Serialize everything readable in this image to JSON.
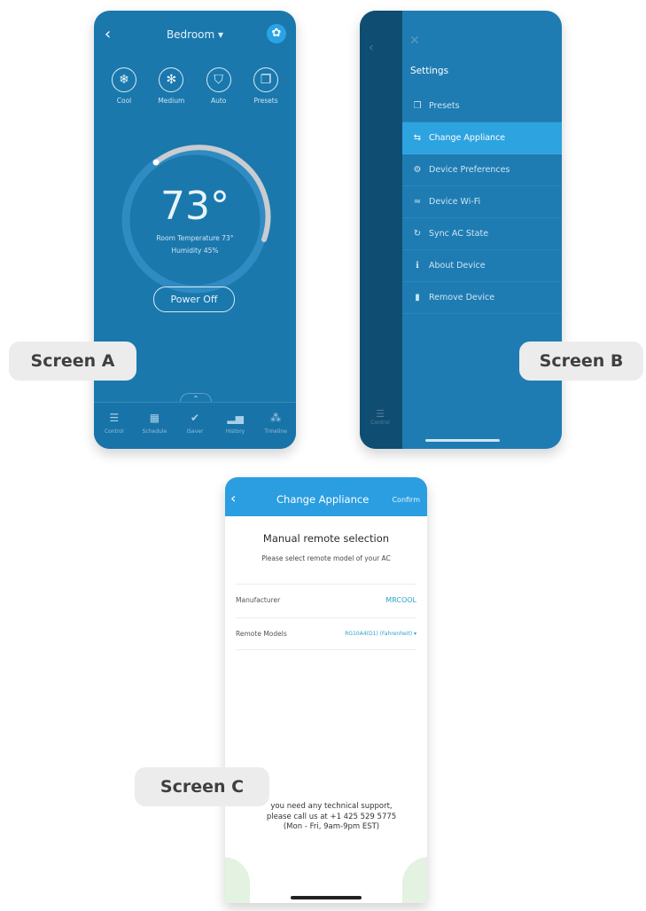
{
  "screen_a": {
    "label": "Screen A",
    "title": "Bedroom ▾",
    "modes": [
      {
        "label": "Cool",
        "icon": "snowflake-icon",
        "glyph": "❄"
      },
      {
        "label": "Medium",
        "icon": "fan-icon",
        "glyph": "✻"
      },
      {
        "label": "Auto",
        "icon": "auto-shield-icon",
        "glyph": "⛉"
      },
      {
        "label": "Presets",
        "icon": "presets-icon",
        "glyph": "❐"
      }
    ],
    "temperature": "73°",
    "room_temperature": "Room Temperature 73°",
    "humidity": "Humidity 45%",
    "power_button": "Power Off",
    "tabs": [
      {
        "label": "Control",
        "glyph": "☰"
      },
      {
        "label": "Schedule",
        "glyph": "▦"
      },
      {
        "label": "iSaver",
        "glyph": "✔"
      },
      {
        "label": "History",
        "glyph": "▂▅"
      },
      {
        "label": "Timeline",
        "glyph": "⁂"
      }
    ]
  },
  "screen_b": {
    "label": "Screen B",
    "settings_title": "Settings",
    "control_label": "Control",
    "menu": [
      {
        "label": "Presets",
        "glyph": "❐",
        "active": false
      },
      {
        "label": "Change Appliance",
        "glyph": "⇆",
        "active": true
      },
      {
        "label": "Device Preferences",
        "glyph": "⚙",
        "active": false
      },
      {
        "label": "Device Wi-Fi",
        "glyph": "≈",
        "active": false
      },
      {
        "label": "Sync AC State",
        "glyph": "↻",
        "active": false
      },
      {
        "label": "About Device",
        "glyph": "ℹ",
        "active": false
      },
      {
        "label": "Remove Device",
        "glyph": "▮",
        "active": false
      }
    ]
  },
  "screen_c": {
    "label": "Screen C",
    "header_title": "Change Appliance",
    "confirm": "Confirm",
    "section_title": "Manual remote selection",
    "section_subtitle": "Please select remote model of your AC",
    "manufacturer_label": "Manufacturer",
    "manufacturer_value": "MRCOOL",
    "remote_models_label": "Remote Models",
    "remote_models_value": "RG10A4(D1) (Fahrenheit) ▾",
    "support_line1": "you need any technical support,",
    "support_line2": "please call us at +1 425 529 5775",
    "support_line3": "(Mon - Fri, 9am-9pm EST)"
  }
}
